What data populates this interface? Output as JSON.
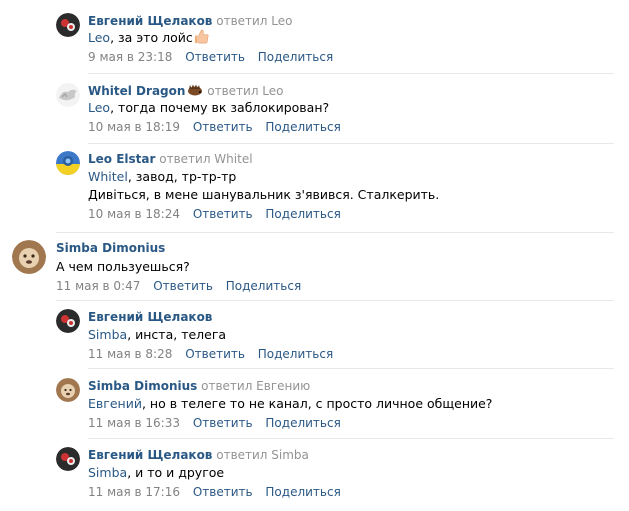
{
  "actions": {
    "reply": "Ответить",
    "share": "Поделиться"
  },
  "comments": [
    {
      "author": "Евгений Щелаков",
      "replied": "ответил Leo",
      "mention": "Leo",
      "text": ", за это лойс",
      "date": "9 мая в 23:18"
    },
    {
      "author": "Whitel Dragon",
      "replied": "ответил Leo",
      "mention": "Leo",
      "text": ", тогда почему вк заблокирован?",
      "date": "10 мая в 18:19"
    },
    {
      "author": "Leo Elstar",
      "replied": "ответил Whitel",
      "mention": "Whitel",
      "text": ", завод, тр-тр-тр",
      "text2": "Дивіться, в мене шанувальник з'явився. Сталкерить.",
      "date": "10 мая в 18:24"
    },
    {
      "author": "Simba Dimonius",
      "text": "А чем пользуешься?",
      "date": "11 мая в 0:47"
    },
    {
      "author": "Евгений Щелаков",
      "mention": "Simba",
      "text": ", инста, телега",
      "date": "11 мая в 8:28"
    },
    {
      "author": "Simba Dimonius",
      "replied": "ответил Евгению",
      "mention": "Евгений",
      "text": ", но в телеге то не канал, с просто личное общение?",
      "date": "11 мая в 16:33"
    },
    {
      "author": "Евгений Щелаков",
      "replied": "ответил Simba",
      "mention": "Simba",
      "text": ", и то и другое",
      "date": "11 мая в 17:16"
    }
  ],
  "icons": {
    "emoji": "thumbs-up-emoji",
    "hedgehog": "hedgehog-emoji"
  },
  "colors": {
    "link": "#2a5885",
    "muted": "#939393",
    "date": "#828282",
    "divider": "#e7e8ec"
  }
}
